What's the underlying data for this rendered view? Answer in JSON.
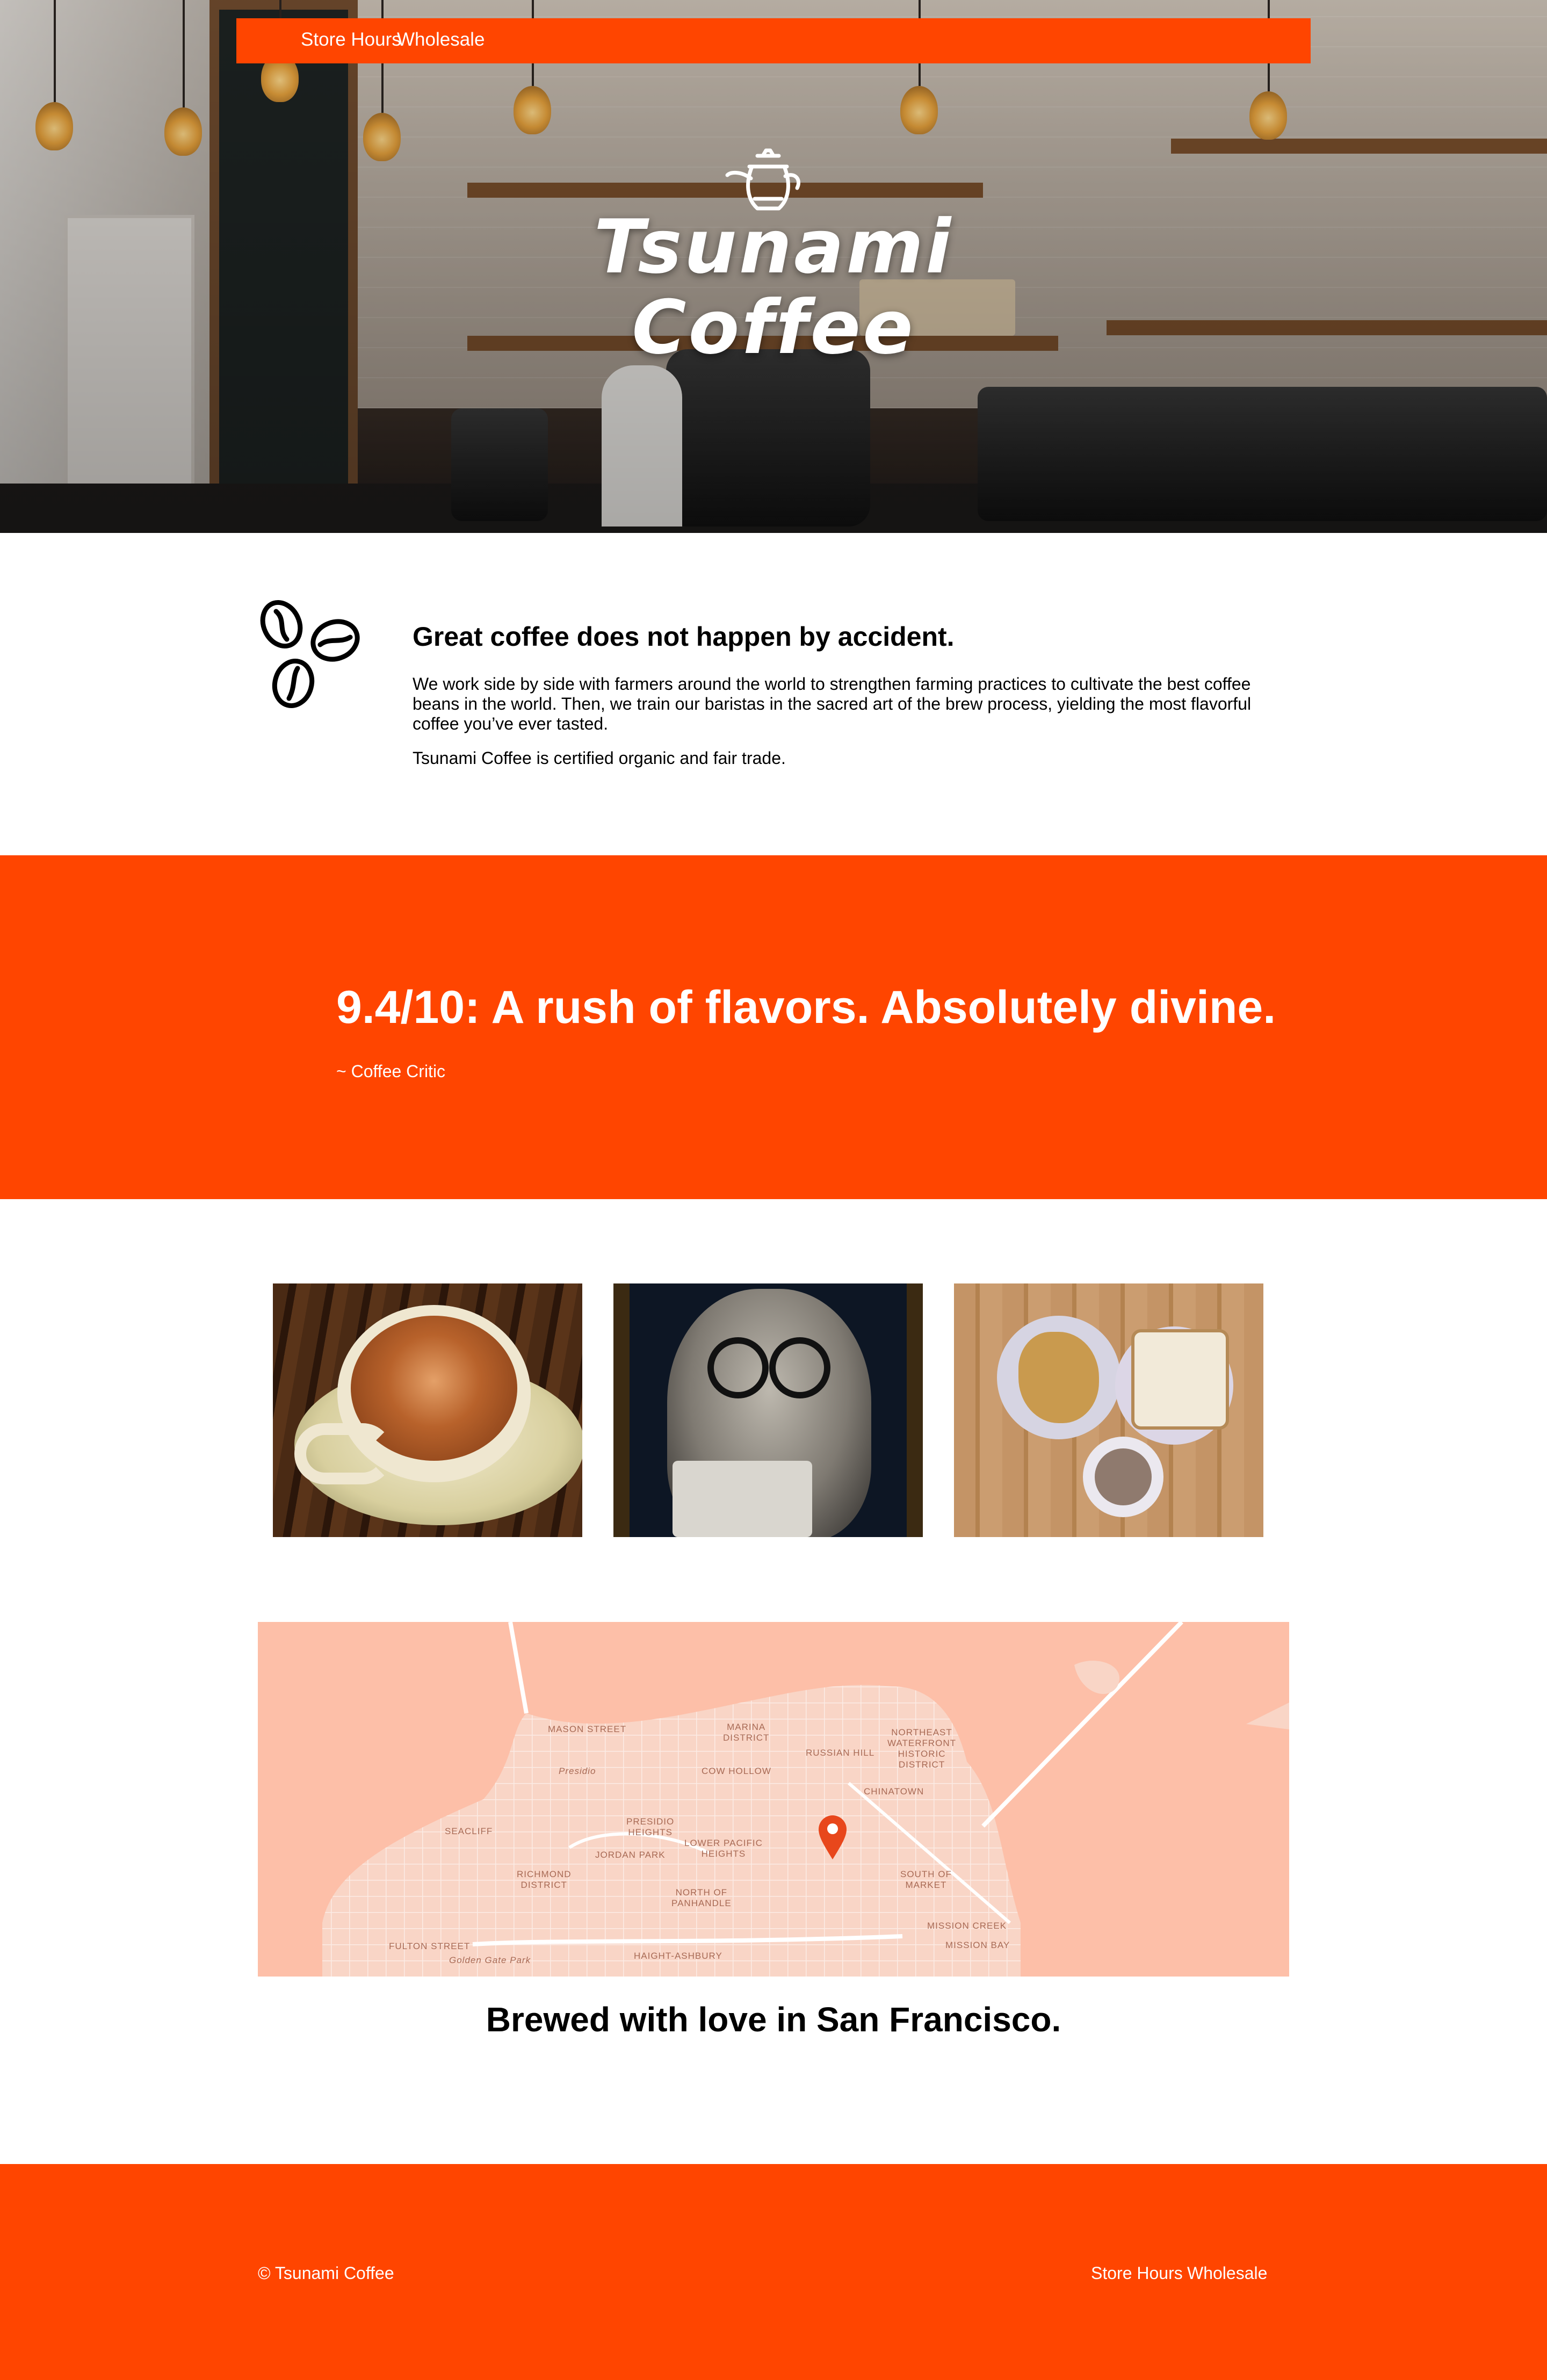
{
  "nav": {
    "store_hours": "Store Hours",
    "wholesale": "Wholesale"
  },
  "hero": {
    "logo_text_line1": "Tsunami",
    "logo_text_line2": "Coffee",
    "logo_icon": "kettle-icon"
  },
  "intro": {
    "icon": "coffee-beans-icon",
    "title": "Great coffee does not happen by accident.",
    "paragraph1": "We work side by side with farmers around the world to strengthen farming practices to cultivate the best coffee beans in the world. Then, we train our baristas in the sacred art of the brew process, yielding the most flavorful coffee you’ve ever tasted.",
    "paragraph2": "Tsunami Coffee is certified organic and fair trade."
  },
  "quote": {
    "text": "9.4/10: A rush of flavors. Absolutely divine.",
    "attribution": "~ Coffee Critic"
  },
  "gallery": {
    "photos": [
      "latte-photo",
      "bearded-man-photo",
      "breakfast-photo"
    ]
  },
  "map": {
    "marker_icon": "map-pin-icon",
    "labels": {
      "marina": "MARINA\nDISTRICT",
      "northeast": "NORTHEAST\nWATERFRONT\nHISTORIC\nDISTRICT",
      "presidio": "Presidio",
      "cow_hollow": "COW HOLLOW",
      "russian_hill": "RUSSIAN HILL",
      "chinatown": "CHINATOWN",
      "seacliff": "SEACLIFF",
      "presidio_heights": "PRESIDIO\nHEIGHTS",
      "jordan_park": "JORDAN PARK",
      "lower_pacific": "LOWER PACIFIC\nHEIGHTS",
      "richmond": "RICHMOND\nDISTRICT",
      "north_panhandle": "NORTH OF\nPANHANDLE",
      "south_market": "SOUTH OF\nMARKET",
      "mission_creek": "MISSION CREEK",
      "mission_bay": "MISSION BAY",
      "fulton": "FULTON STREET",
      "golden_gate": "Golden Gate Park",
      "haight": "HAIGHT-ASHBURY",
      "mason": "MASON STREET"
    },
    "caption": "Brewed with love in San Francisco."
  },
  "footer": {
    "copyright": "© Tsunami Coffee",
    "store_hours": "Store Hours",
    "wholesale": "Wholesale"
  },
  "colors": {
    "accent": "#ff4500",
    "map_background": "#fdbfa8"
  }
}
